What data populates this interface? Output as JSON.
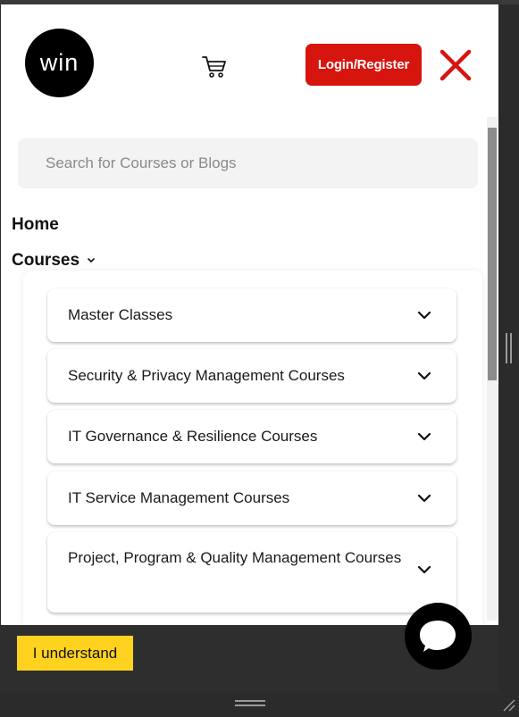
{
  "header": {
    "logo_text": "win",
    "cart_icon": "cart-icon",
    "login_label": "Login/Register",
    "close_icon": "close-icon"
  },
  "search": {
    "placeholder": "Search for Courses or Blogs",
    "value": ""
  },
  "nav": {
    "home_label": "Home",
    "courses_label": "Courses"
  },
  "courses_menu": [
    {
      "label": "Master Classes"
    },
    {
      "label": "Security & Privacy Management Courses"
    },
    {
      "label": "IT Governance & Resilience Courses"
    },
    {
      "label": "IT Service Management Courses"
    },
    {
      "label": "Project, Program & Quality Management Courses"
    }
  ],
  "cookie": {
    "understand_label": "I understand"
  },
  "chat": {
    "icon": "chat-bubble-icon"
  },
  "colors": {
    "brand_red": "#d7150f",
    "close_red": "#d7150f",
    "cookie_yellow": "#ffd21f"
  }
}
